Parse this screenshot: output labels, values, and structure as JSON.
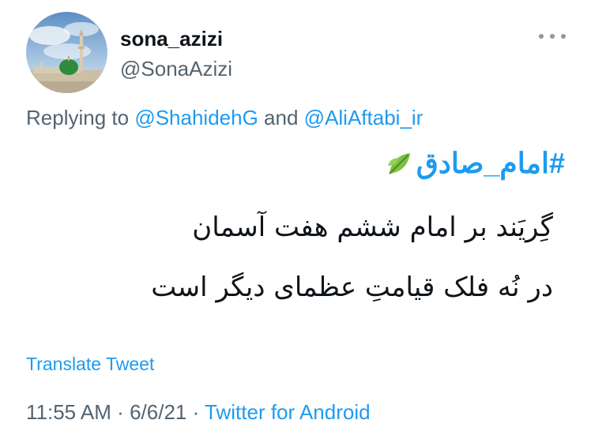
{
  "tweet": {
    "display_name": "sona_azizi",
    "handle": "@SonaAzizi",
    "replying_prefix": "Replying to",
    "reply_to_1": "@ShahidehG",
    "reply_and": "and",
    "reply_to_2": "@AliAftabi_ir",
    "hashtag": "#امام_صادق",
    "hashtag_icon": "leaf-icon",
    "lines": [
      "گِریَند بر امام ششم هفت آسمان",
      "در نُه فلک قیامتِ عظمای دیگر است"
    ],
    "translate_label": "Translate Tweet",
    "time": "11:55 AM",
    "date": "6/6/21",
    "separator": "·",
    "source": "Twitter for Android"
  },
  "colors": {
    "link": "#1d9bf0",
    "secondary_text": "#536471",
    "primary_text": "#0f1419"
  },
  "icons": {
    "avatar": "avatar-mosque-image",
    "more": "more-options-icon"
  }
}
